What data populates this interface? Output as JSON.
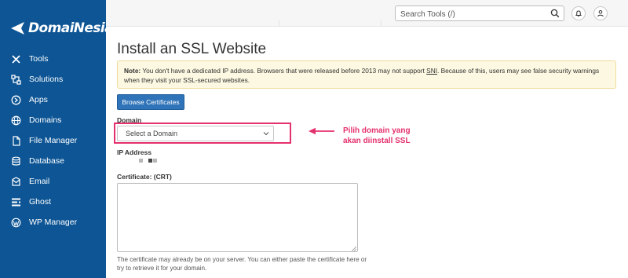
{
  "brand": {
    "name": "DomaiNesia"
  },
  "sidebar": {
    "items": [
      {
        "label": "Tools",
        "icon": "tools-icon"
      },
      {
        "label": "Solutions",
        "icon": "solutions-icon"
      },
      {
        "label": "Apps",
        "icon": "apps-icon"
      },
      {
        "label": "Domains",
        "icon": "globe-icon"
      },
      {
        "label": "File Manager",
        "icon": "file-icon"
      },
      {
        "label": "Database",
        "icon": "database-icon"
      },
      {
        "label": "Email",
        "icon": "email-icon"
      },
      {
        "label": "Ghost",
        "icon": "ghost-icon"
      },
      {
        "label": "WP Manager",
        "icon": "wordpress-icon"
      }
    ]
  },
  "header": {
    "search": {
      "placeholder": "Search Tools (/)"
    }
  },
  "page": {
    "title": "Install an SSL Website",
    "note": {
      "label": "Note:",
      "text_before": " You don't have a dedicated IP address. Browsers that were released before 2013 may not support ",
      "sni": "SNI",
      "text_after": ". Because of this, users may see false security warnings when they visit your SSL-secured websites."
    },
    "browse_button": "Browse Certificates",
    "domain_label": "Domain",
    "domain_select": "Select a Domain",
    "ip_label": "IP Address",
    "cert_label": "Certificate: (CRT)",
    "help_text": "The certificate may already be on your server. You can either paste the certificate here or try to retrieve it for your domain."
  },
  "annotation": {
    "line1": "Pilih domain yang",
    "line2": "akan diinstall SSL",
    "color": "#e5306e"
  },
  "colors": {
    "sidebar": "#0d5595",
    "primary_button": "#2f73b8",
    "note_background": "#fcf8e1"
  }
}
